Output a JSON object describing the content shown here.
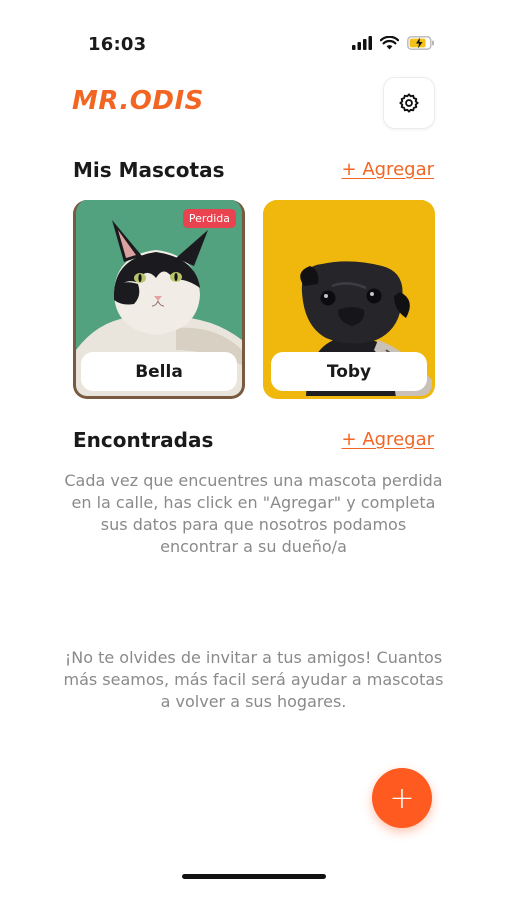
{
  "status_bar": {
    "time": "16:03"
  },
  "header": {
    "logo": "MR.ODIS"
  },
  "my_pets": {
    "title": "Mis Mascotas",
    "add_label": "+ Agregar",
    "pets": [
      {
        "name": "Bella",
        "badge": "Perdida"
      },
      {
        "name": "Toby"
      }
    ]
  },
  "found": {
    "title": "Encontradas",
    "add_label": "+ Agregar",
    "empty_text": "Cada vez que encuentres una mascota perdida en la calle, has click en \"Agregar\" y completa sus datos para que nosotros podamos encontrar a su dueño/a"
  },
  "invite_text": "¡No te olvides de invitar a tus amigos! Cuantos más seamos, más facil será ayudar a mascotas a volver a sus hogares.",
  "fab": {
    "label": "+"
  },
  "colors": {
    "accent": "#f26522",
    "fab": "#ff5a1f",
    "lost_badge": "#e8434f",
    "bella_bg": "#4f9d7a",
    "toby_bg": "#f0b80c"
  }
}
